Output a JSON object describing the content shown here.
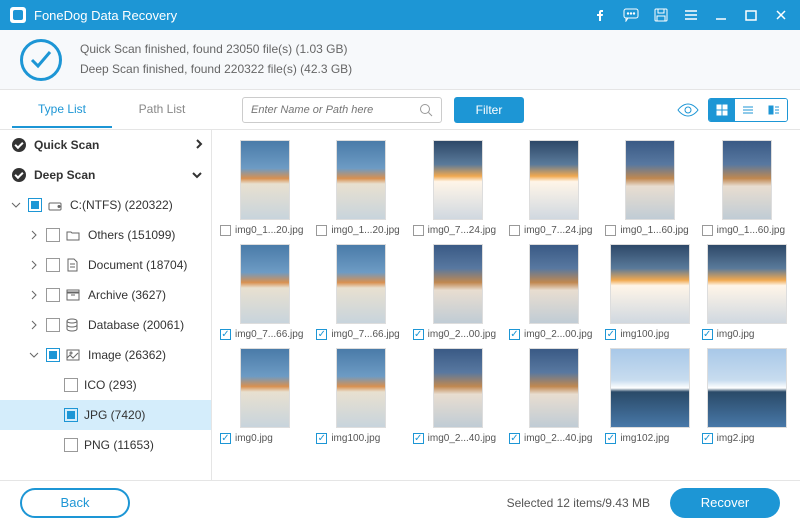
{
  "app_title": "FoneDog Data Recovery",
  "status": {
    "line1": "Quick Scan finished, found 23050 file(s) (1.03 GB)",
    "line2": "Deep Scan finished, found 220322 file(s) (42.3 GB)"
  },
  "tabs": {
    "type_list": "Type List",
    "path_list": "Path List"
  },
  "search_placeholder": "Enter Name or Path here",
  "filter_label": "Filter",
  "tree": {
    "quick_scan": "Quick Scan",
    "deep_scan": "Deep Scan",
    "drive": "C:(NTFS) (220322)",
    "others": "Others (151099)",
    "document": "Document (18704)",
    "archive": "Archive (3627)",
    "database": "Database (20061)",
    "image": "Image (26362)",
    "ico": "ICO (293)",
    "jpg": "JPG (7420)",
    "png": "PNG (11653)"
  },
  "thumbs": [
    {
      "name": "img0_1...20.jpg",
      "checked": false,
      "v": "a",
      "p": true
    },
    {
      "name": "img0_1...20.jpg",
      "checked": false,
      "v": "a",
      "p": true
    },
    {
      "name": "img0_7...24.jpg",
      "checked": false,
      "v": "b",
      "p": true
    },
    {
      "name": "img0_7...24.jpg",
      "checked": false,
      "v": "b",
      "p": true
    },
    {
      "name": "img0_1...60.jpg",
      "checked": false,
      "v": "c",
      "p": true
    },
    {
      "name": "img0_1...60.jpg",
      "checked": false,
      "v": "c",
      "p": true
    },
    {
      "name": "img0_7...66.jpg",
      "checked": true,
      "v": "a",
      "p": true
    },
    {
      "name": "img0_7...66.jpg",
      "checked": true,
      "v": "a",
      "p": true
    },
    {
      "name": "img0_2...00.jpg",
      "checked": true,
      "v": "c",
      "p": true
    },
    {
      "name": "img0_2...00.jpg",
      "checked": true,
      "v": "c",
      "p": true
    },
    {
      "name": "img100.jpg",
      "checked": true,
      "v": "b",
      "p": false
    },
    {
      "name": "img0.jpg",
      "checked": true,
      "v": "b",
      "p": false
    },
    {
      "name": "img0.jpg",
      "checked": true,
      "v": "a",
      "p": true
    },
    {
      "name": "img100.jpg",
      "checked": true,
      "v": "a",
      "p": true
    },
    {
      "name": "img0_2...40.jpg",
      "checked": true,
      "v": "c",
      "p": true
    },
    {
      "name": "img0_2...40.jpg",
      "checked": true,
      "v": "c",
      "p": true
    },
    {
      "name": "img102.jpg",
      "checked": true,
      "v": "d",
      "p": false
    },
    {
      "name": "img2.jpg",
      "checked": true,
      "v": "d",
      "p": false
    }
  ],
  "footer": {
    "back": "Back",
    "selected": "Selected 12 items/9.43 MB",
    "recover": "Recover"
  }
}
